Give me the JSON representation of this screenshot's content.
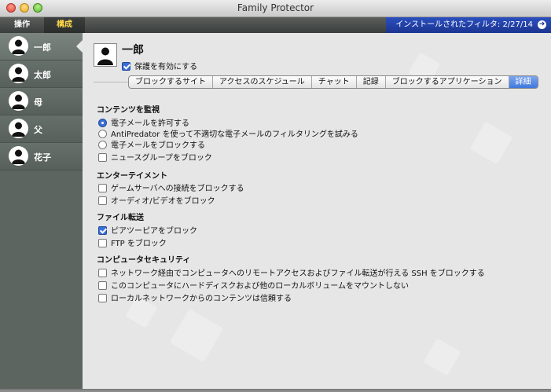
{
  "window": {
    "title": "Family Protector"
  },
  "toolbar": {
    "tab_operations": "操作",
    "tab_config": "構成",
    "filter_status": "インストールされたフィルタ: 2/27/14"
  },
  "sidebar": {
    "users": [
      {
        "name": "一郎",
        "selected": true
      },
      {
        "name": "太郎",
        "selected": false
      },
      {
        "name": "母",
        "selected": false
      },
      {
        "name": "父",
        "selected": false
      },
      {
        "name": "花子",
        "selected": false
      }
    ]
  },
  "profile": {
    "name": "一郎",
    "enable_label": "保護を有効にする",
    "enable_checked": true
  },
  "tabs": [
    {
      "label": "ブロックするサイト",
      "active": false
    },
    {
      "label": "アクセスのスケジュール",
      "active": false
    },
    {
      "label": "チャット",
      "active": false
    },
    {
      "label": "記録",
      "active": false
    },
    {
      "label": "ブロックするアプリケーション",
      "active": false
    },
    {
      "label": "詳細",
      "active": true
    }
  ],
  "sections": {
    "content_monitoring": {
      "title": "コンテンツを監視",
      "radio_allow_email": "電子メールを許可する",
      "radio_filter_email": "AntiPredator を使って不適切な電子メールのフィルタリングを試みる",
      "radio_block_email": "電子メールをブロックする",
      "selected_radio": "radio_allow_email",
      "cb_block_newsgroups": "ニュースグループをブロック"
    },
    "entertainment": {
      "title": "エンターテイメント",
      "cb_block_game_servers": "ゲームサーバへの接続をブロックする",
      "cb_block_audio_video": "オーディオ/ビデオをブロック"
    },
    "file_transfer": {
      "title": "ファイル転送",
      "cb_block_p2p": "ピアツーピアをブロック",
      "cb_block_p2p_checked": true,
      "cb_block_ftp": "FTP をブロック"
    },
    "security": {
      "title": "コンピュータセキュリティ",
      "cb_block_ssh": "ネットワーク経由でコンピュータへのリモートアクセスおよびファイル転送が行える SSH をブロックする",
      "cb_no_mount": "このコンピュータにハードディスクおよび他のローカルボリュームをマウントしない",
      "cb_trust_local": "ローカルネットワークからのコンテンツは信頼する"
    }
  },
  "colors": {
    "accent": "#3b6fd8",
    "filter_bar": "#1b3590",
    "config_tab_text": "#ffd84a",
    "sidebar": "#5d6561"
  },
  "icons": {
    "avatar": "person-silhouette-icon",
    "close": "close-icon",
    "minimize": "minimize-icon",
    "zoom": "zoom-icon",
    "filter_arrow": "arrow-right-circle-icon"
  }
}
